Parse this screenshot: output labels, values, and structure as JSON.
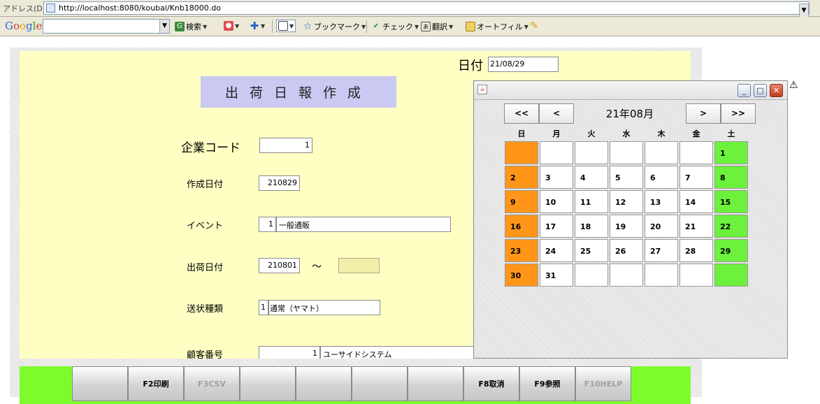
{
  "browser": {
    "address_label": "アドレス(D)",
    "url": "http://localhost:8080/koubai/Knb18000.do"
  },
  "google_toolbar": {
    "logo": "Google",
    "search_label": "検索",
    "bookmark_label": "ブックマーク",
    "check_label": "チェック",
    "translate_label": "翻訳",
    "autofill_label": "オートフィル"
  },
  "form": {
    "title": "出荷日報作成",
    "date_label": "日付",
    "date_value": "21/08/29",
    "company_code_label": "企業コード",
    "company_code_value": "1",
    "created_date_label": "作成日付",
    "created_date_value": "210829",
    "event_label": "イベント",
    "event_code": "1",
    "event_name": "一般通販",
    "ship_date_label": "出荷日付",
    "ship_date_from": "210801",
    "tilde": "～",
    "ship_date_to": "",
    "invoice_type_label": "送状種類",
    "invoice_type_code": "1",
    "invoice_type_name": "通常（ヤマト）",
    "customer_no_label": "顧客番号",
    "customer_no_code": "1",
    "customer_no_name": "ユーサイドシステム"
  },
  "function_keys": {
    "f2": "F2印刷",
    "f3": "F3CSV",
    "f8": "F8取消",
    "f9": "F9参照",
    "f10": "F10HELP"
  },
  "calendar": {
    "prev_year": "<<",
    "prev_month": "<",
    "next_month": ">",
    "next_year": ">>",
    "month_label": "21年08月",
    "weekdays": [
      "日",
      "月",
      "火",
      "水",
      "木",
      "金",
      "土"
    ],
    "days": [
      "1",
      "2",
      "3",
      "4",
      "5",
      "6",
      "7",
      "8",
      "9",
      "10",
      "11",
      "12",
      "13",
      "14",
      "15",
      "16",
      "17",
      "18",
      "19",
      "20",
      "21",
      "22",
      "23",
      "24",
      "25",
      "26",
      "27",
      "28",
      "29",
      "30",
      "31"
    ]
  },
  "colors": {
    "form_background": "#ffffc4",
    "title_background": "#c9c9f2",
    "function_bar": "#7dfc2d",
    "sunday": "#ff9619",
    "saturday": "#6cf13c"
  }
}
